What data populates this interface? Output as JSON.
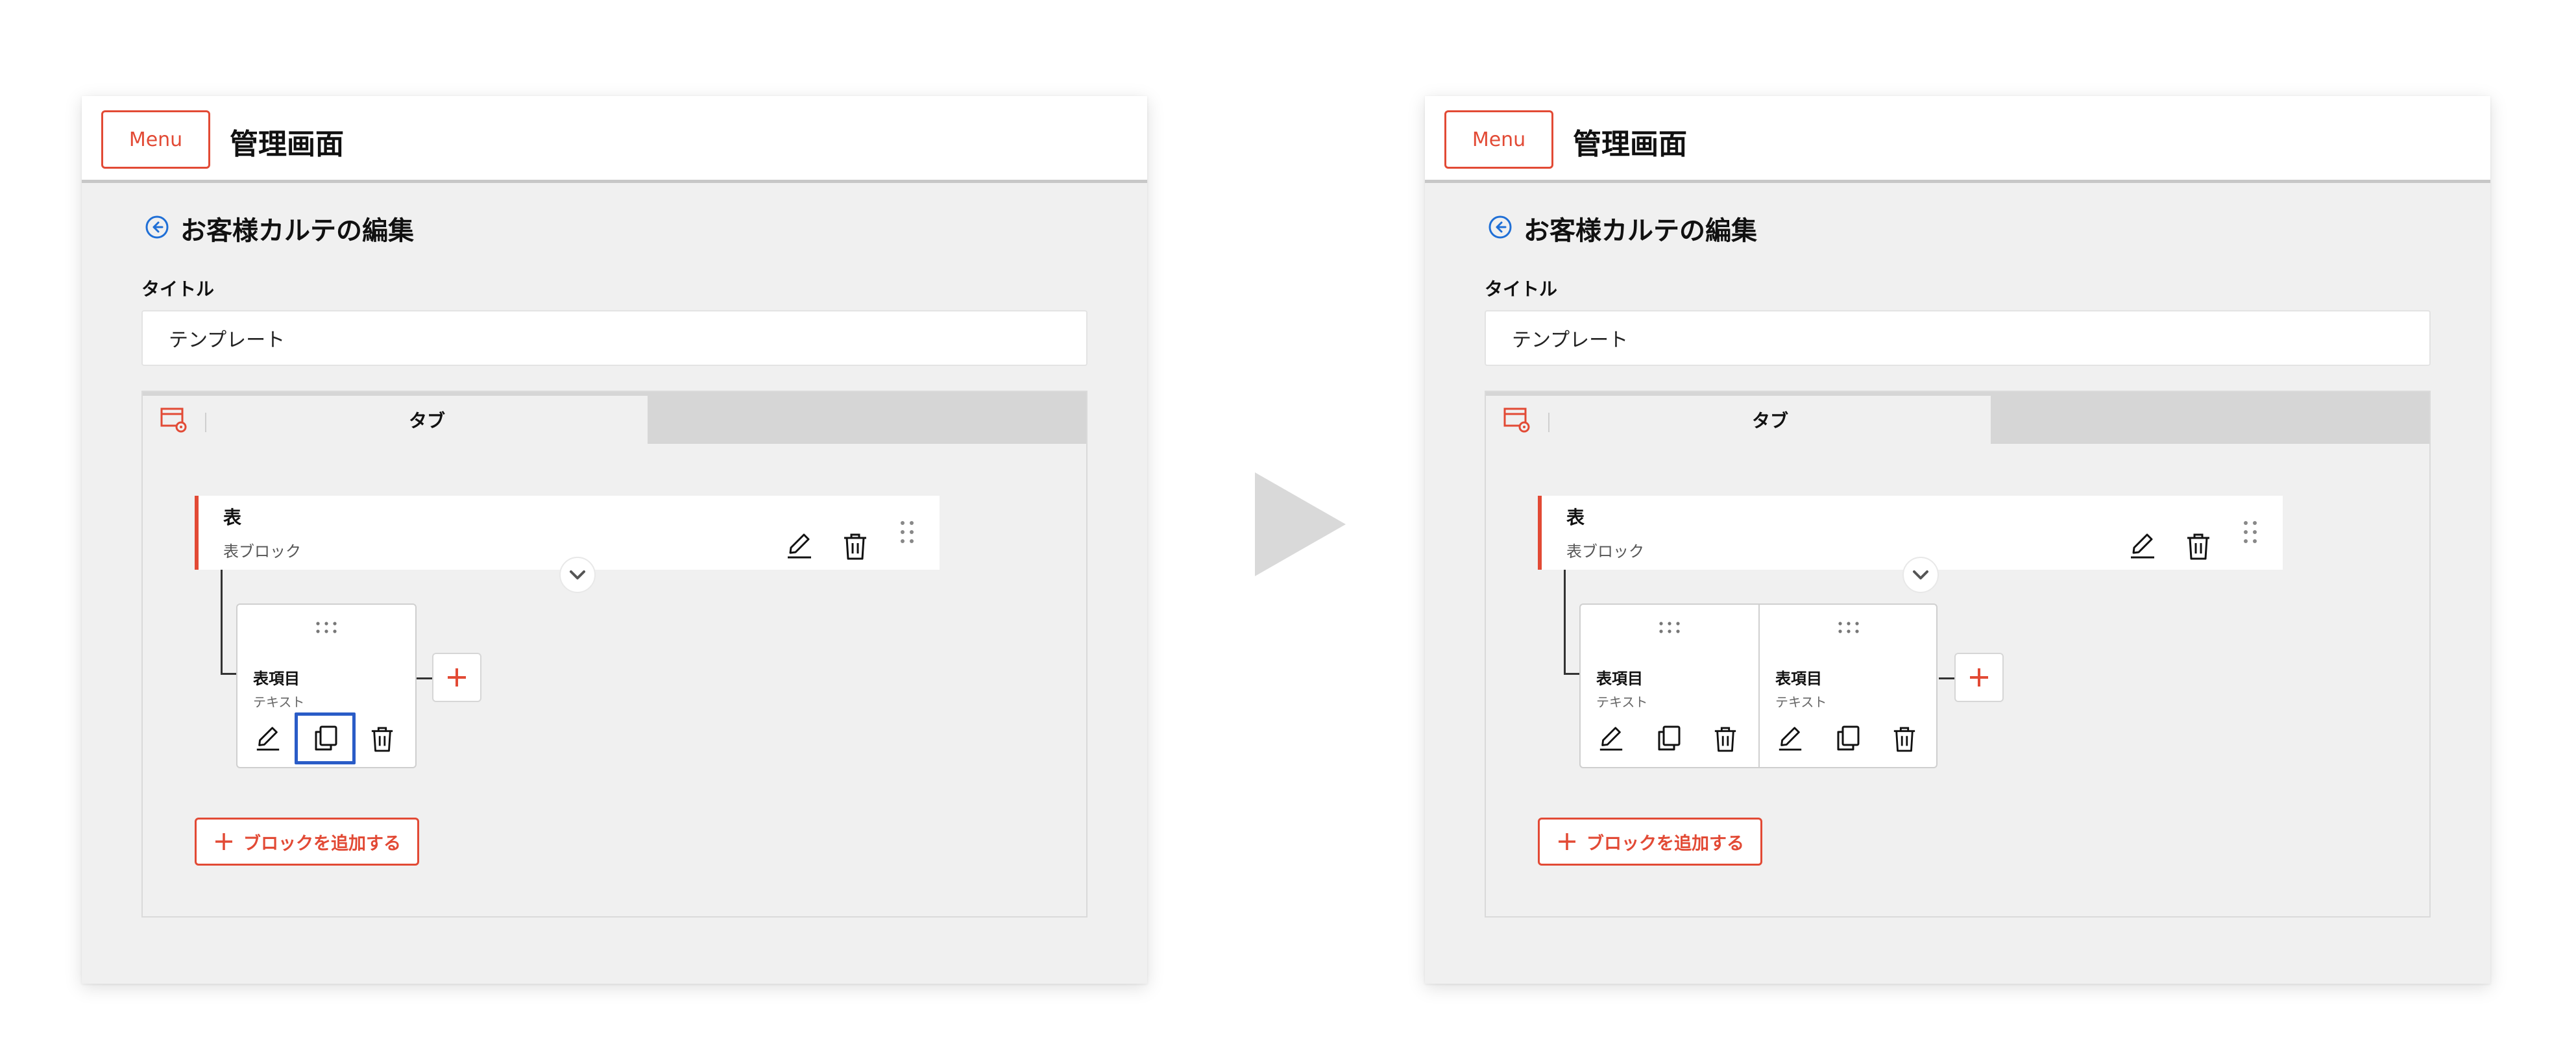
{
  "colors": {
    "accent": "#e24a35",
    "highlight": "#2a5cc7",
    "panel_bg": "#f0f0f0"
  },
  "panels": [
    {
      "menu_label": "Menu",
      "app_title": "管理画面",
      "page_title": "お客様カルテの編集",
      "title_label": "タイトル",
      "title_value": "テンプレート",
      "tab_label": "タブ",
      "block": {
        "name": "表",
        "type": "表ブロック"
      },
      "items": [
        {
          "name": "表項目",
          "type": "テキスト"
        }
      ],
      "add_block_label": "ブロックを追加する"
    },
    {
      "menu_label": "Menu",
      "app_title": "管理画面",
      "page_title": "お客様カルテの編集",
      "title_label": "タイトル",
      "title_value": "テンプレート",
      "tab_label": "タブ",
      "block": {
        "name": "表",
        "type": "表ブロック"
      },
      "items": [
        {
          "name": "表項目",
          "type": "テキスト"
        },
        {
          "name": "表項目",
          "type": "テキスト"
        }
      ],
      "add_block_label": "ブロックを追加する"
    }
  ],
  "icons": {
    "back": "back-circle-icon",
    "tab_settings": "tab-settings-icon",
    "edit": "pencil-icon",
    "delete": "trash-icon",
    "copy": "copy-icon",
    "drag": "drag-handle-icon",
    "expand": "chevron-down-icon",
    "add": "plus-icon",
    "transition": "play-arrow-icon"
  }
}
